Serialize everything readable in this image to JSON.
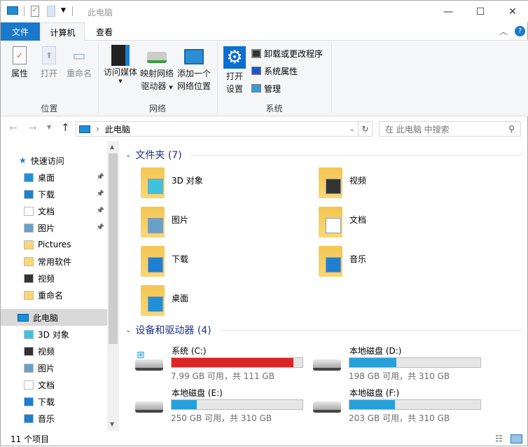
{
  "window": {
    "title": "此电脑",
    "minimize": "—",
    "maximize": "☐",
    "close": "✕"
  },
  "tabs": {
    "file": "文件",
    "computer": "计算机",
    "view": "查看"
  },
  "ribbon": {
    "location": {
      "label": "位置",
      "properties": "属性",
      "open": "打开",
      "rename": "重命名"
    },
    "network": {
      "label": "网络",
      "media": "访问媒体",
      "map1": "映射网络",
      "map2": "驱动器",
      "add1": "添加一个",
      "add2": "网络位置"
    },
    "system": {
      "label": "系统",
      "settings1": "打开",
      "settings2": "设置",
      "uninstall": "卸载或更改程序",
      "sysprops": "系统属性",
      "manage": "管理"
    }
  },
  "address": {
    "path": "此电脑",
    "search_placeholder": "在 此电脑 中搜索"
  },
  "nav": {
    "quick_access": "快速访问",
    "quick_items": [
      {
        "label": "桌面",
        "pinned": true
      },
      {
        "label": "下载",
        "pinned": true
      },
      {
        "label": "文档",
        "pinned": true
      },
      {
        "label": "图片",
        "pinned": true
      },
      {
        "label": "Pictures"
      },
      {
        "label": "常用软件"
      },
      {
        "label": "视频"
      },
      {
        "label": "重命名"
      }
    ],
    "this_pc": "此电脑",
    "pc_items": [
      "3D 对象",
      "视频",
      "图片",
      "文档",
      "下载",
      "音乐"
    ]
  },
  "folders": {
    "header": "文件夹 (7)",
    "items": [
      "3D 对象",
      "视频",
      "图片",
      "文档",
      "下载",
      "音乐",
      "桌面"
    ]
  },
  "drives": {
    "header": "设备和驱动器 (4)",
    "items": [
      {
        "name": "系统 (C:)",
        "free": "7.99 GB 可用，共 111 GB",
        "used_fraction": 0.93,
        "color": "#da2626"
      },
      {
        "name": "本地磁盘 (D:)",
        "free": "198 GB 可用，共 310 GB",
        "used_fraction": 0.36,
        "color": "#26a0da"
      },
      {
        "name": "本地磁盘 (E:)",
        "free": "250 GB 可用，共 310 GB",
        "used_fraction": 0.19,
        "color": "#26a0da"
      },
      {
        "name": "本地磁盘 (F:)",
        "free": "203 GB 可用，共 310 GB",
        "used_fraction": 0.345,
        "color": "#26a0da"
      }
    ]
  },
  "status": {
    "count": "11 个项目"
  }
}
